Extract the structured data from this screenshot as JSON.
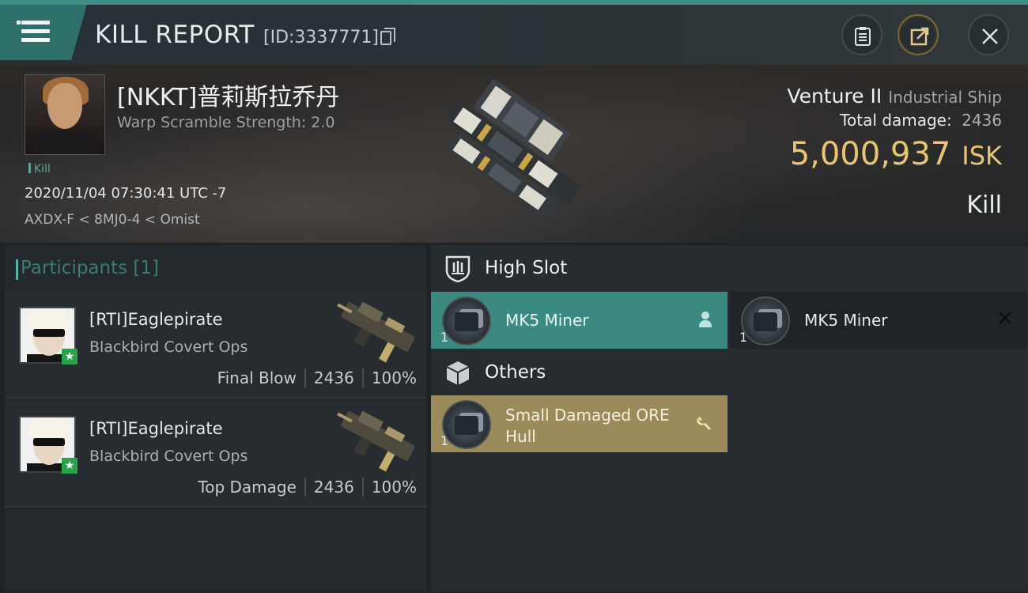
{
  "header": {
    "title": "KILL REPORT",
    "report_id": "[ID:3337771]"
  },
  "victim": {
    "name": "[NKKT]普莉斯拉乔丹",
    "warp_scramble": "Warp Scramble Strength: 2.0",
    "tag": "Kill",
    "datetime": "2020/11/04 07:30:41 UTC -7",
    "location": "AXDX-F < 8MJ0-4 < Omist",
    "ship_name": "Venture II",
    "ship_class": "Industrial Ship",
    "total_damage_label": "Total damage:",
    "total_damage": "2436",
    "isk_value": "5,000,937",
    "isk_unit": "ISK",
    "result": "Kill"
  },
  "participants": {
    "title": "Participants [1]",
    "rows": [
      {
        "name": "[RTI]Eaglepirate",
        "ship": "Blackbird Covert Ops",
        "role": "Final Blow",
        "damage": "2436",
        "percent": "100%"
      },
      {
        "name": "[RTI]Eaglepirate",
        "ship": "Blackbird Covert Ops",
        "role": "Top Damage",
        "damage": "2436",
        "percent": "100%"
      }
    ]
  },
  "fitting": {
    "high_slot": {
      "label": "High Slot",
      "items": [
        {
          "name": "MK5 Miner",
          "qty": "1",
          "state": "selected"
        },
        {
          "name": "MK5 Miner",
          "qty": "1",
          "state": "destroyed"
        }
      ]
    },
    "others": {
      "label": "Others",
      "items": [
        {
          "name": "Small Damaged ORE Hull",
          "qty": "1",
          "state": "dropped"
        }
      ]
    }
  },
  "icons": {
    "menu": "hamburger-menu-icon",
    "copy": "copy-icon",
    "clipboard": "clipboard-icon",
    "share": "share-icon",
    "close": "close-icon",
    "high_slot": "high-slot-icon",
    "others": "cube-icon",
    "pilot": "person-icon",
    "destroyed": "x-icon",
    "dropped": "wrench-icon"
  },
  "colors": {
    "accent": "#3b8a82",
    "isk": "#e9c572",
    "dropped": "#9c8b5a"
  }
}
